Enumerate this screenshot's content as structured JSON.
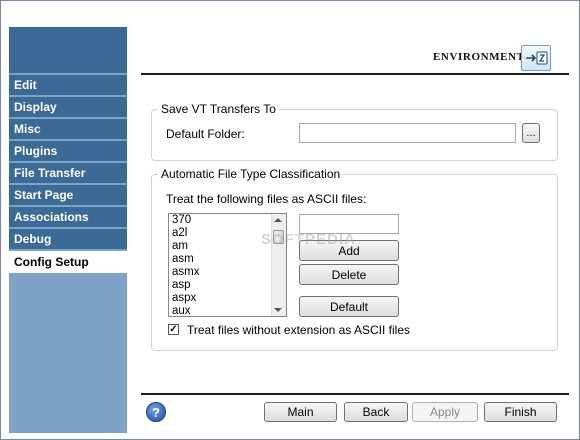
{
  "header": {
    "title": "ENVIRONMENT",
    "icon": "environment-settings-icon"
  },
  "sidebar": {
    "items": [
      {
        "label": "Edit",
        "active": false
      },
      {
        "label": "Display",
        "active": false
      },
      {
        "label": "Misc",
        "active": false
      },
      {
        "label": "Plugins",
        "active": false
      },
      {
        "label": "File Transfer",
        "active": false
      },
      {
        "label": "Start Page",
        "active": false
      },
      {
        "label": "Associations",
        "active": false
      },
      {
        "label": "Debug",
        "active": false
      },
      {
        "label": "Config Setup",
        "active": true
      }
    ]
  },
  "save_vt": {
    "legend": "Save VT Transfers To",
    "folder_label": "Default Folder:",
    "folder_value": "",
    "browse_label": "..."
  },
  "classification": {
    "legend": "Automatic File Type Classification",
    "treat_label": "Treat the following files as ASCII files:",
    "extensions": [
      "370",
      "a2l",
      "am",
      "asm",
      "asmx",
      "asp",
      "aspx",
      "aux"
    ],
    "new_ext_value": "",
    "add_label": "Add",
    "delete_label": "Delete",
    "default_label": "Default",
    "no_ext_checkbox_label": "Treat files without extension as ASCII files",
    "no_ext_checked": true
  },
  "footer": {
    "help_icon": "?",
    "main_label": "Main",
    "back_label": "Back",
    "apply_label": "Apply",
    "finish_label": "Finish"
  },
  "watermark": "SOFTPEDIA",
  "colors": {
    "sidebar_dark": "#3c6a96",
    "sidebar_light": "#7fa3c7"
  }
}
